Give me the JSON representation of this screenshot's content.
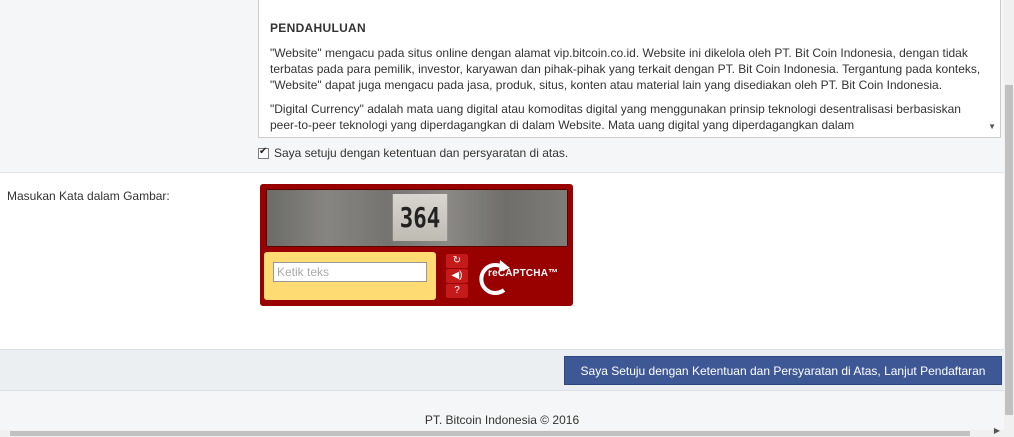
{
  "terms": {
    "heading": "PENDAHULUAN",
    "paragraph1": "\"Website\" mengacu pada situs online dengan alamat vip.bitcoin.co.id. Website ini dikelola oleh PT. Bit Coin Indonesia, dengan tidak terbatas pada para pemilik, investor, karyawan dan pihak-pihak yang terkait dengan PT. Bit Coin Indonesia. Tergantung pada konteks, \"Website\" dapat juga mengacu pada jasa, produk, situs, konten atau material lain yang disediakan oleh PT. Bit Coin Indonesia.",
    "paragraph2": "\"Digital Currency\" adalah mata uang digital atau komoditas digital yang menggunakan prinsip teknologi desentralisasi berbasiskan peer-to-peer teknologi yang diperdagangkan di dalam Website. Mata uang digital yang diperdagangkan dalam"
  },
  "agreement": {
    "label": "Saya setuju dengan ketentuan dan persyaratan di atas.",
    "checked": true
  },
  "captcha": {
    "label": "Masukan Kata dalam Gambar:",
    "image_text": "364",
    "input_placeholder": "Ketik teks",
    "logo_text": "reCAPTCHA™",
    "icons": [
      "refresh-icon",
      "audio-icon",
      "help-icon"
    ]
  },
  "footer": {
    "continue_label": "Saya Setuju dengan Ketentuan dan Persyaratan di Atas, Lanjut Pendaftaran",
    "copyright": "PT. Bitcoin Indonesia © 2016"
  },
  "colors": {
    "button_bg": "#3e5896",
    "captcha_red": "#990000",
    "captcha_yellow": "#ffdc73"
  }
}
